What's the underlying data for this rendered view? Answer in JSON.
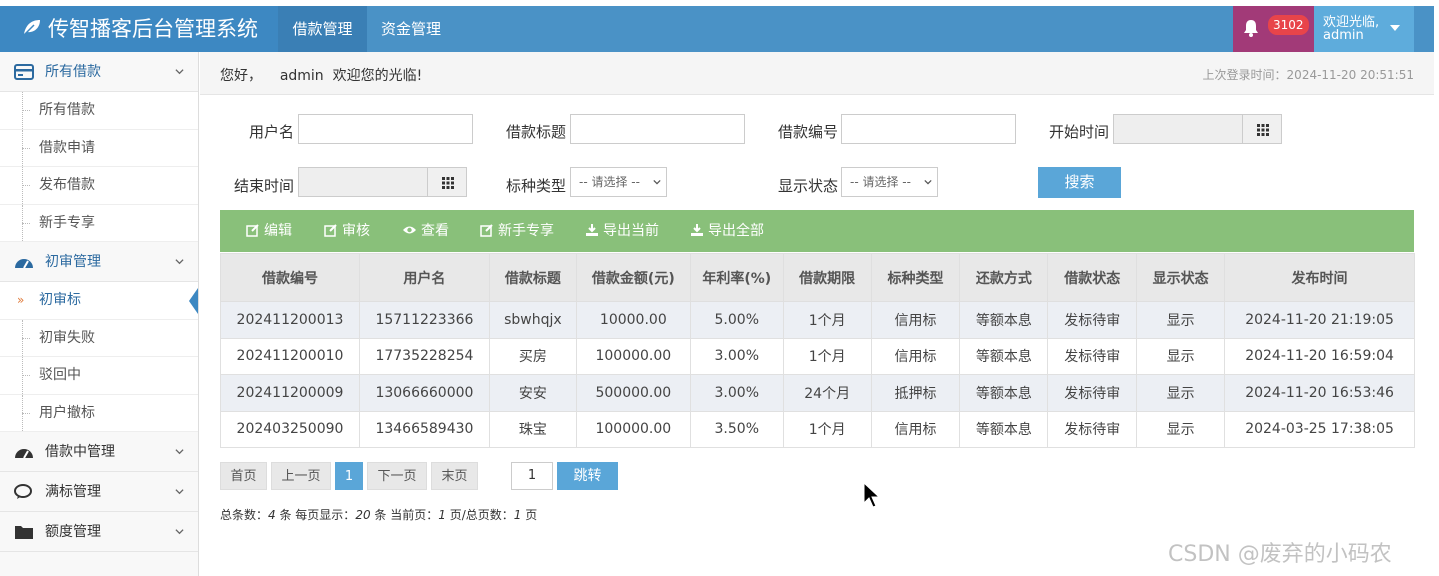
{
  "header": {
    "title": "传智播客后台管理系统",
    "tabs": [
      {
        "label": "借款管理",
        "active": true
      },
      {
        "label": "资金管理",
        "active": false
      }
    ],
    "notification_count": "3102",
    "user_greeting": "欢迎光临,",
    "username": "admin",
    "colors": {
      "bar": "#4a92c6",
      "notif": "#a23a78",
      "user": "#5eacdc"
    }
  },
  "sidebar": {
    "groups": [
      {
        "label": "所有借款",
        "icon": "card-icon",
        "open": true,
        "items": [
          "所有借款",
          "借款申请",
          "发布借款",
          "新手专享"
        ]
      },
      {
        "label": "初审管理",
        "icon": "dashboard-icon",
        "open": true,
        "items": [
          "初审标",
          "初审失败",
          "驳回中",
          "用户撤标"
        ],
        "active_item": "初审标"
      },
      {
        "label": "借款中管理",
        "icon": "dashboard-icon",
        "open": false,
        "items": []
      },
      {
        "label": "满标管理",
        "icon": "comments-icon",
        "open": false,
        "items": []
      },
      {
        "label": "额度管理",
        "icon": "folder-icon",
        "open": false,
        "items": []
      }
    ]
  },
  "welcome": {
    "greeting": "您好，",
    "user": "admin",
    "message": "欢迎您的光临!",
    "last_login": "上次登录时间：2024-11-20 20:51:51"
  },
  "filters": {
    "username_label": "用户名",
    "title_label": "借款标题",
    "number_label": "借款编号",
    "start_label": "开始时间",
    "end_label": "结束时间",
    "type_label": "标种类型",
    "type_value": "-- 请选择 --",
    "status_label": "显示状态",
    "status_value": "-- 请选择 --",
    "search_label": "搜索"
  },
  "toolbar": {
    "edit": "编辑",
    "review": "审核",
    "view": "查看",
    "newbie": "新手专享",
    "export_current": "导出当前",
    "export_all": "导出全部"
  },
  "table": {
    "columns": [
      "借款编号",
      "用户名",
      "借款标题",
      "借款金额(元)",
      "年利率(%)",
      "借款期限",
      "标种类型",
      "还款方式",
      "借款状态",
      "显示状态",
      "发布时间"
    ],
    "rows": [
      [
        "202411200013",
        "15711223366",
        "sbwhqjx",
        "10000.00",
        "5.00%",
        "1个月",
        "信用标",
        "等额本息",
        "发标待审",
        "显示",
        "2024-11-20 21:19:05"
      ],
      [
        "202411200010",
        "17735228254",
        "买房",
        "100000.00",
        "3.00%",
        "1个月",
        "信用标",
        "等额本息",
        "发标待审",
        "显示",
        "2024-11-20 16:59:04"
      ],
      [
        "202411200009",
        "13066660000",
        "安安",
        "500000.00",
        "3.00%",
        "24个月",
        "抵押标",
        "等额本息",
        "发标待审",
        "显示",
        "2024-11-20 16:53:46"
      ],
      [
        "202403250090",
        "13466589430",
        "珠宝",
        "100000.00",
        "3.50%",
        "1个月",
        "信用标",
        "等额本息",
        "发标待审",
        "显示",
        "2024-03-25 17:38:05"
      ]
    ]
  },
  "pagination": {
    "first": "首页",
    "prev": "上一页",
    "current": "1",
    "next": "下一页",
    "last": "末页",
    "jump_value": "1",
    "jump_label": "跳转",
    "summary": {
      "total_label": "总条数：",
      "total": "4",
      "per_page_label": "条 每页显示：",
      "per_page": "20",
      "current_label": "条 当前页：",
      "current_page": "1",
      "pages_label": "页/总页数：",
      "pages": "1",
      "tail": "页"
    }
  },
  "watermark": "CSDN @废弃的小码农"
}
